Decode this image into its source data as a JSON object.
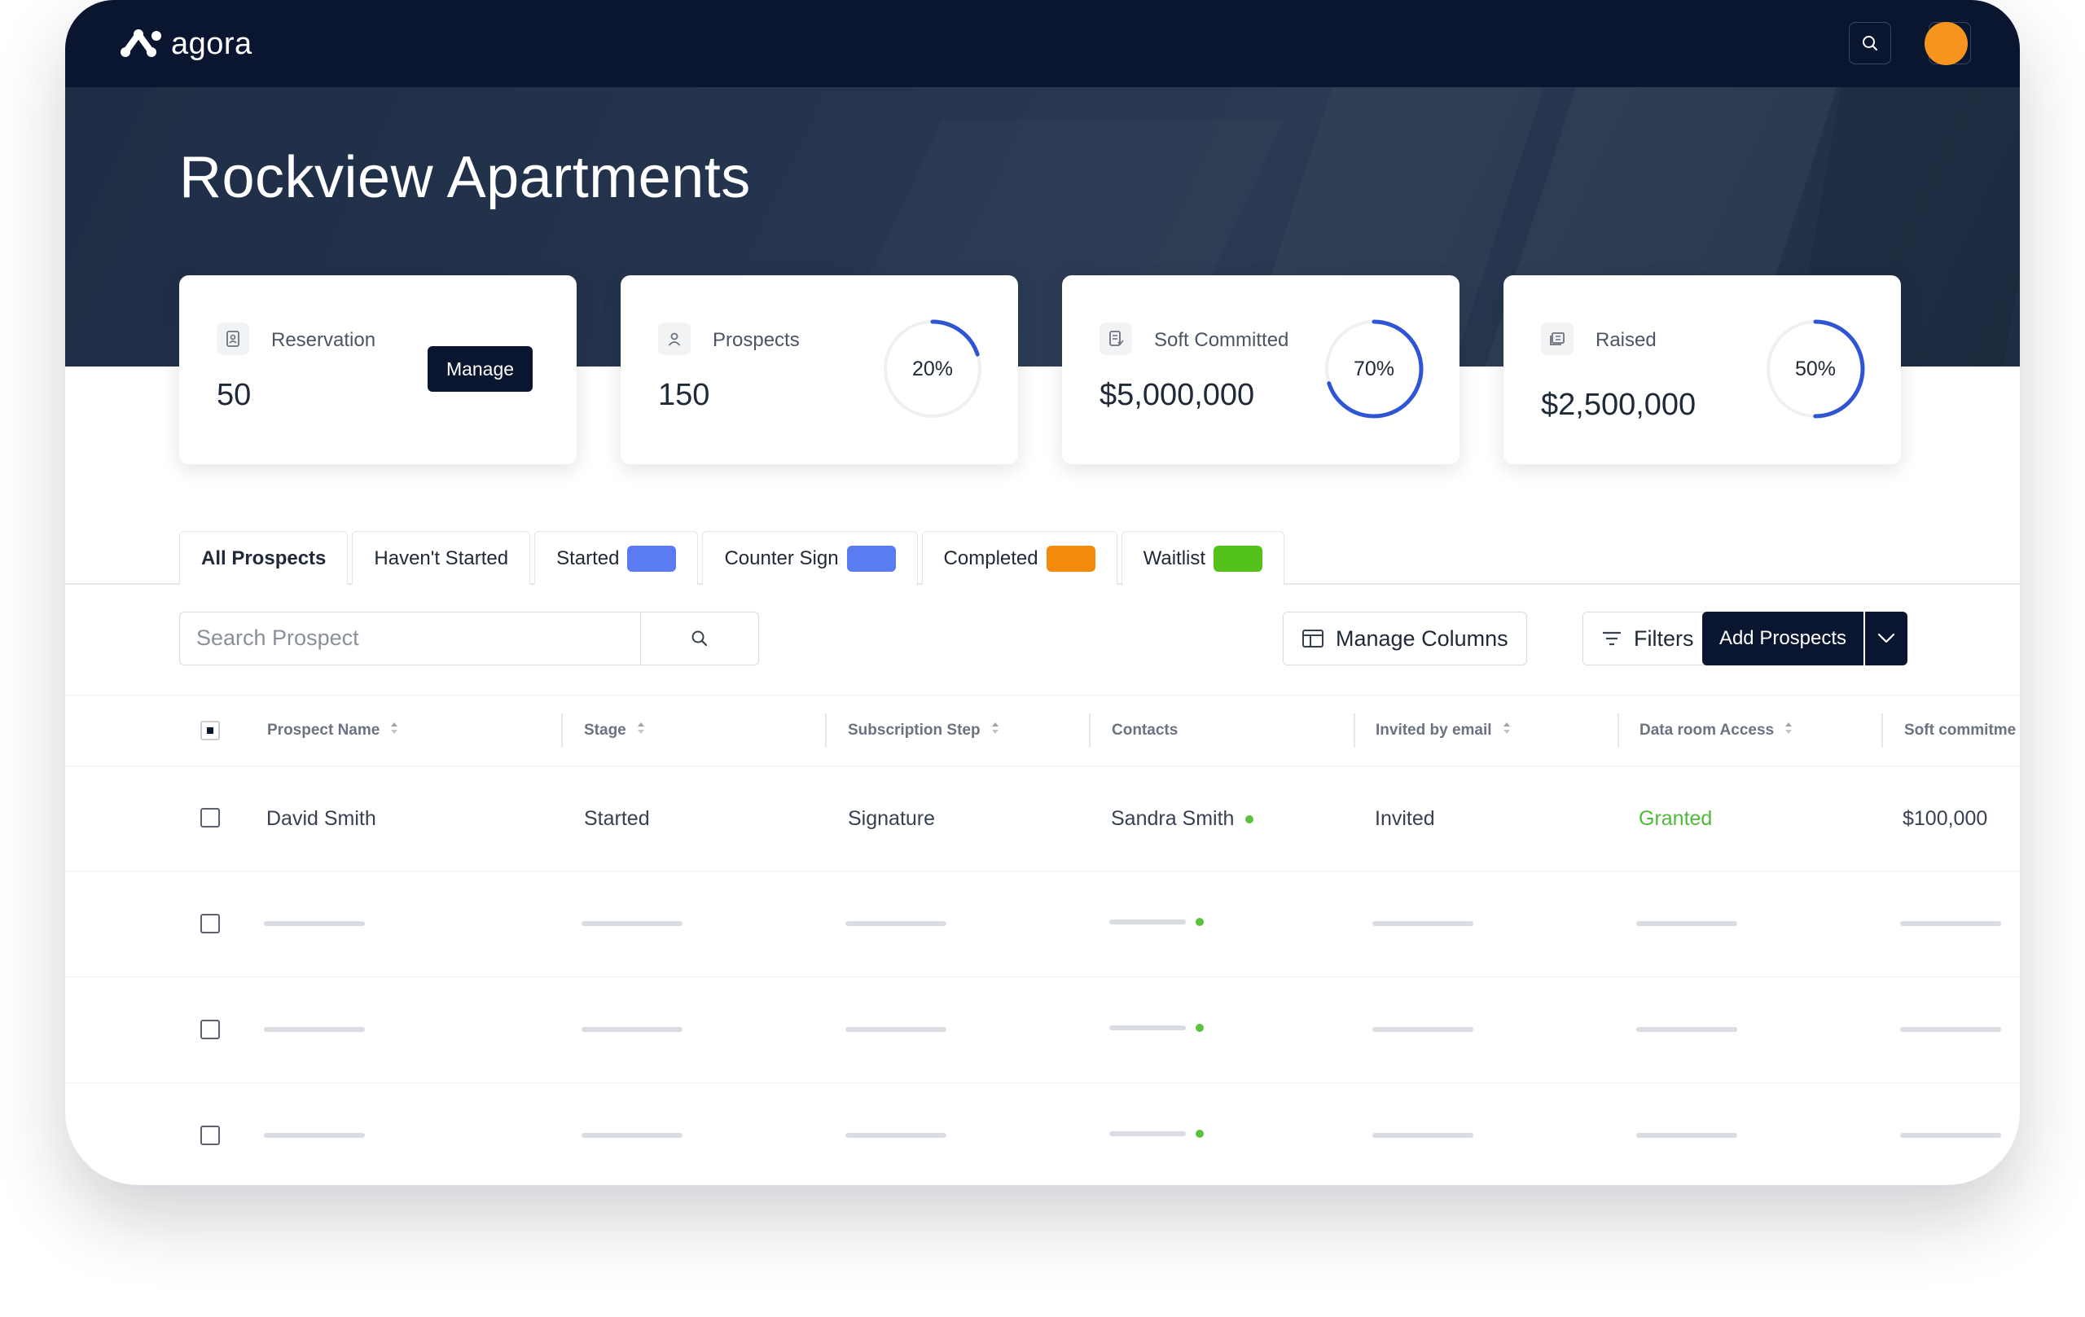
{
  "app": {
    "logo_text": "agora"
  },
  "header": {
    "title": "Rockview Apartments"
  },
  "stats": [
    {
      "label": "Reservation",
      "value": "50",
      "action": "Manage",
      "icon": "reservation-icon"
    },
    {
      "label": "Prospects",
      "value": "150",
      "percent_label": "20%",
      "percent": 0.2,
      "icon": "user-icon"
    },
    {
      "label": "Soft Committed",
      "value": "$5,000,000",
      "percent_label": "70%",
      "percent": 0.7,
      "icon": "document-icon"
    },
    {
      "label": "Raised",
      "value": "$2,500,000",
      "percent_label": "50%",
      "percent": 0.5,
      "icon": "ledger-icon"
    }
  ],
  "tabs": [
    {
      "label": "All Prospects",
      "active": true
    },
    {
      "label": "Haven't Started"
    },
    {
      "label": "Started",
      "chip_color": "#5b7cf0"
    },
    {
      "label": "Counter Sign",
      "chip_color": "#5b7cf0"
    },
    {
      "label": "Completed",
      "chip_color": "#f28a0c"
    },
    {
      "label": "Waitlist",
      "chip_color": "#52c21a"
    }
  ],
  "toolbar": {
    "search_placeholder": "Search Prospect",
    "manage_columns": "Manage Columns",
    "filters": "Filters",
    "add_prospects": "Add Prospects"
  },
  "table": {
    "columns": [
      "Prospect Name",
      "Stage",
      "Subscription Step",
      "Contacts",
      "Invited by email",
      "Data room Access",
      "Soft commitme"
    ],
    "rows": [
      {
        "name": "David Smith",
        "stage": "Started",
        "step": "Signature",
        "contact": "Sandra Smith",
        "invited": "Invited",
        "access": "Granted",
        "soft": "$100,000"
      }
    ]
  },
  "colors": {
    "navy": "#0a1630",
    "accent_blue": "#2f55d4",
    "avatar_orange": "#f7941d",
    "success_green": "#4fb93a"
  }
}
